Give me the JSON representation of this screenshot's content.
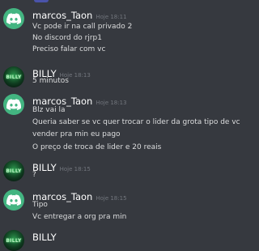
{
  "messages": [
    {
      "username": "marcos_Taon",
      "timestamp": "Hoje 18:11",
      "avatar": "discord-logo-icon",
      "lines": [
        "Vc pode ir na call privado 2",
        "No discord do rjrp1",
        "Preciso falar com vc"
      ]
    },
    {
      "username": "BILLY",
      "timestamp": "Hoje 18:13",
      "avatar": "billy-avatar",
      "avatar_text": "BILLY",
      "lines": [
        "5 minutos"
      ]
    },
    {
      "username": "marcos_Taon",
      "timestamp": "Hoje 18:13",
      "avatar": "discord-logo-icon",
      "lines": [
        "Blz vai la",
        "Queria saber se vc quer trocar o lider da grota tipo de vc",
        "vender pra min eu pago",
        "O preço de troca de lider e 20 reais"
      ]
    },
    {
      "username": "BILLY",
      "timestamp": "Hoje 18:15",
      "avatar": "billy-avatar",
      "avatar_text": "BILLY",
      "lines": [
        "?"
      ]
    },
    {
      "username": "marcos_Taon",
      "timestamp": "Hoje 18:15",
      "avatar": "discord-logo-icon",
      "lines": [
        "Tipo",
        "Vc entregar a org pra min"
      ]
    },
    {
      "username": "BILLY",
      "timestamp": "",
      "avatar": "billy-avatar",
      "avatar_text": "BILLY",
      "lines": []
    }
  ],
  "colors": {
    "background": "#36393f",
    "username": "#ffffff",
    "timestamp": "#72767d",
    "text": "#dcddde",
    "discord_avatar": "#43b581"
  }
}
